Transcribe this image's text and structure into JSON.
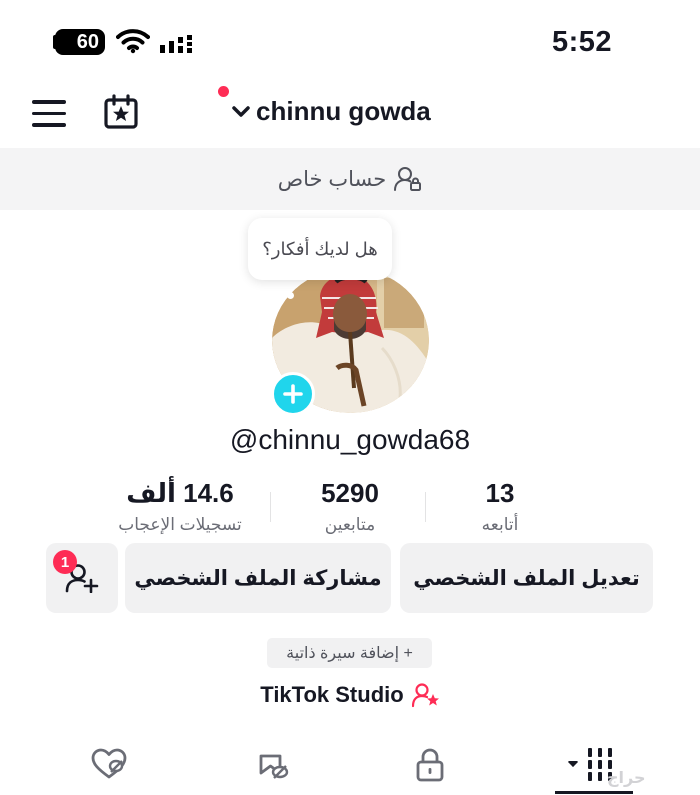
{
  "status_bar": {
    "battery": "60",
    "time": "5:52"
  },
  "header": {
    "username": "chinnu gowda"
  },
  "private_banner": {
    "text": "حساب خاص"
  },
  "profile": {
    "ideas_bubble": "هل لديك أفكار؟",
    "handle": "@chinnu_gowda68"
  },
  "stats": {
    "likes": {
      "value": "14.6 ألف",
      "label": "تسجيلات الإعجاب"
    },
    "followers": {
      "value": "5290",
      "label": "متابعين"
    },
    "following": {
      "value": "13",
      "label": "أتابعه"
    }
  },
  "actions": {
    "add_friend_badge": "1",
    "share_label": "مشاركة الملف الشخصي",
    "edit_label": "تعديل الملف الشخصي",
    "bio_label": "+ إضافة سيرة ذاتية"
  },
  "studio": {
    "label": "TikTok Studio"
  },
  "tabs": [
    "liked-videos",
    "favorites",
    "private",
    "videos-grid"
  ],
  "watermark": "حراج",
  "colors": {
    "accent_red": "#fe2c55",
    "accent_cyan": "#20d5ec",
    "text": "#161823"
  }
}
